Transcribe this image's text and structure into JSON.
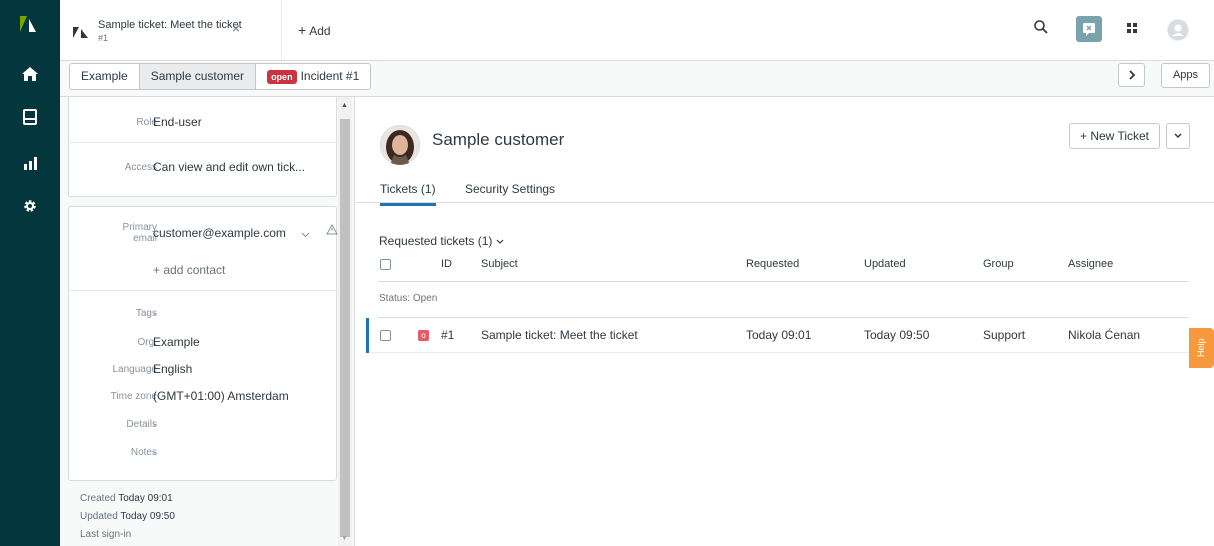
{
  "tab": {
    "title": "Sample ticket: Meet the ticket",
    "subtitle": "#1",
    "close": "×"
  },
  "add_label": "Add",
  "breadcrumb": {
    "org": "Example",
    "customer": "Sample customer",
    "status_badge": "open",
    "incident": "Incident #1"
  },
  "apps_label": "Apps",
  "user_fields": {
    "role_label": "Role",
    "role_value": "End-user",
    "access_label": "Access",
    "access_value": "Can view and edit own tick...",
    "email_label_1": "Primary",
    "email_label_2": "email",
    "email_value": "customer@example.com",
    "add_contact": "+ add contact",
    "tags_label": "Tags",
    "tags_value": "-",
    "org_label": "Org.",
    "org_value": "Example",
    "language_label": "Language",
    "language_value": "English",
    "timezone_label": "Time zone",
    "timezone_value": "(GMT+01:00) Amsterdam",
    "details_label": "Details",
    "details_value": "-",
    "notes_label": "Notes",
    "notes_value": "-"
  },
  "meta": {
    "created_label": "Created",
    "created_value": "Today 09:01",
    "updated_label": "Updated",
    "updated_value": "Today 09:50",
    "signin_label": "Last sign-in"
  },
  "customer": {
    "name": "Sample customer"
  },
  "new_ticket_label": "+ New Ticket",
  "tabs": [
    {
      "label": "Tickets (1)"
    },
    {
      "label": "Security Settings"
    }
  ],
  "requested_title": "Requested tickets (1)",
  "table": {
    "headers": [
      "ID",
      "Subject",
      "Requested",
      "Updated",
      "Group",
      "Assignee"
    ],
    "status_group": "Status: Open",
    "rows": [
      {
        "status_letter": "o",
        "id": "#1",
        "subject": "Sample ticket: Meet the ticket",
        "requested": "Today 09:01",
        "updated": "Today 09:50",
        "group": "Support",
        "assignee": "Nikola Ćenan"
      }
    ]
  },
  "help_label": "Help",
  "colors": {
    "nav_bg": "#03363d",
    "open_badge": "#cc3340",
    "accent": "#1f73b7",
    "help": "#f79a3e"
  }
}
